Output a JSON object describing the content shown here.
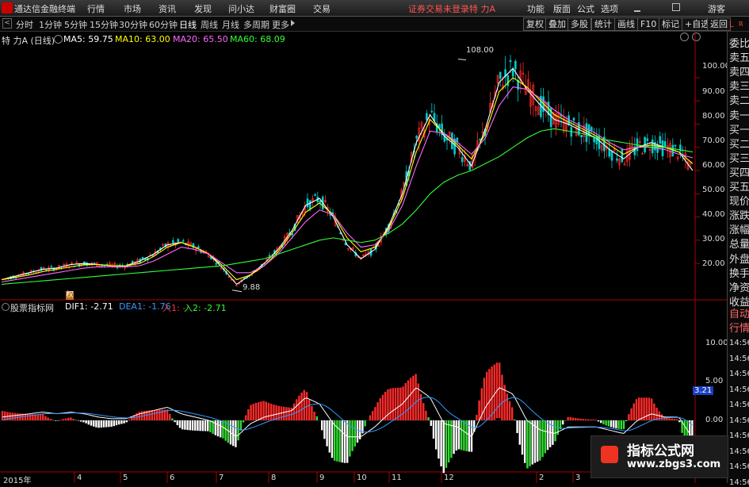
{
  "topbar": {
    "app_name": "通达信金融终端",
    "menu": [
      "行情",
      "市场",
      "资讯",
      "发现",
      "问小达",
      "财富圈",
      "交易"
    ],
    "status_warning": "证券交易未登录",
    "stock_name": "特 力A",
    "right_menu": [
      "功能",
      "版面",
      "公式",
      "选项"
    ],
    "guest": "游客"
  },
  "toolbar": {
    "periods": [
      "分时",
      "1分钟",
      "5分钟",
      "15分钟",
      "30分钟",
      "60分钟",
      "日线",
      "周线",
      "月线",
      "多周期",
      "更多"
    ],
    "active_period": "日线",
    "right_buttons": [
      "复权",
      "叠加",
      "多股",
      "统计",
      "画线",
      "F10",
      "标记",
      "+自选",
      "返回"
    ]
  },
  "main_chart": {
    "title": "特 力A (日线)",
    "ma": [
      {
        "label": "MA5: 59.75",
        "color": "#ffffff"
      },
      {
        "label": "MA10: 63.00",
        "color": "#ffff00"
      },
      {
        "label": "MA20: 65.50",
        "color": "#ff66ff"
      },
      {
        "label": "MA60: 68.09",
        "color": "#33ff33"
      }
    ],
    "y_ticks": [
      "100.00",
      "90.00",
      "80.00",
      "70.00",
      "60.00",
      "50.00",
      "40.00",
      "30.00",
      "20.00"
    ],
    "high_label": "108.00",
    "low_label": "9.88",
    "marker": "权"
  },
  "indicator": {
    "name": "股票指标网",
    "dif": {
      "label": "DIF1: -2.71",
      "color": "#ffffff"
    },
    "dea": {
      "label": "DEA1: -1.76",
      "color": "#3399ff"
    },
    "in1": {
      "label": "入1: -",
      "color": "#ff3333"
    },
    "in2": {
      "label": "入2: -2.71",
      "color": "#33ff33"
    },
    "y_ticks": [
      "10.00",
      "5.00",
      "0.00"
    ],
    "cur_value": "3.21"
  },
  "x_axis": [
    "2015年",
    "4",
    "5",
    "6",
    "7",
    "8",
    "9",
    "10",
    "11",
    "12",
    "2",
    "3"
  ],
  "right_panel": {
    "top_label": "L",
    "top_sub": "R",
    "items": [
      "委比",
      "卖五",
      "卖四",
      "卖三",
      "卖二",
      "卖一",
      "买一",
      "买二",
      "买三",
      "买四",
      "买五",
      "现价",
      "涨跌",
      "涨幅",
      "总量",
      "外盘",
      "换手",
      "净资",
      "收益",
      "自动",
      "行情",
      "14:56",
      "14:56",
      "14:56",
      "14:56",
      "14:56",
      "14:56",
      "14:56",
      "14:56",
      "14:56",
      "14:56"
    ]
  },
  "watermark": {
    "title": "指标公式网",
    "url": "www.zbgs3.com"
  },
  "colors": {
    "up": "#ff2a2a",
    "down": "#33dd33",
    "neutral": "#ffffff",
    "grid": "#7a0000",
    "axis": "#aa0000"
  },
  "chart_data": {
    "type": "line",
    "title": "特 力A (日线)",
    "ylim": [
      5,
      115
    ],
    "x": [
      0,
      5,
      10,
      15,
      20,
      25,
      30,
      35,
      40,
      45,
      50,
      55,
      60,
      65,
      70,
      75,
      80,
      85,
      90,
      95,
      100,
      105,
      110,
      115,
      120,
      125,
      130,
      135,
      140,
      145,
      150,
      155,
      160,
      165,
      170,
      175,
      180,
      185,
      190,
      195,
      200,
      205,
      210,
      215,
      220,
      225,
      230,
      235,
      240,
      245,
      250
    ],
    "series": [
      {
        "name": "MA5",
        "values": [
          13,
          14.5,
          16,
          17.5,
          18,
          19.5,
          20,
          19.5,
          19,
          19,
          21,
          24,
          28,
          29,
          27,
          24,
          18,
          11,
          15,
          20,
          26,
          34,
          45,
          48,
          40,
          28,
          22,
          26,
          36,
          50,
          72,
          84,
          75,
          70,
          62,
          78,
          98,
          104,
          95,
          88,
          82,
          80,
          77,
          74,
          69,
          65,
          70,
          72,
          70,
          68,
          60
        ]
      },
      {
        "name": "MA10",
        "values": [
          13,
          14,
          15,
          16.5,
          17.5,
          18.5,
          19.5,
          19.5,
          19,
          19,
          20,
          23,
          27,
          29,
          27,
          24,
          19,
          13,
          15,
          19,
          25,
          33,
          42,
          46,
          41,
          31,
          25,
          27,
          35,
          48,
          68,
          82,
          76,
          71,
          65,
          76,
          94,
          100,
          96,
          90,
          84,
          81,
          78,
          75,
          71,
          67,
          70,
          71,
          70,
          68,
          63
        ]
      },
      {
        "name": "MA20",
        "values": [
          12,
          13,
          14,
          15,
          16,
          17,
          18,
          18.5,
          18.5,
          18.5,
          19,
          21,
          24,
          27,
          26,
          24,
          20,
          16,
          16,
          19,
          24,
          31,
          38,
          43,
          41,
          33,
          27,
          28,
          34,
          45,
          62,
          77,
          76,
          72,
          67,
          74,
          88,
          96,
          95,
          91,
          86,
          82,
          79,
          76,
          72,
          69,
          70,
          70,
          69,
          67,
          65.5
        ]
      },
      {
        "name": "MA60",
        "values": [
          11,
          11.5,
          12,
          12.5,
          13,
          13.5,
          14,
          14.5,
          15,
          15.5,
          16,
          16.5,
          17,
          17.5,
          18,
          18.5,
          19,
          20,
          21,
          22,
          24,
          26,
          28,
          30,
          31,
          30,
          29,
          30,
          33,
          37,
          43,
          50,
          55,
          58,
          60,
          63,
          66,
          70,
          74,
          77,
          78,
          77,
          76,
          74,
          73,
          72,
          71,
          70,
          70,
          69,
          68
        ]
      }
    ]
  }
}
